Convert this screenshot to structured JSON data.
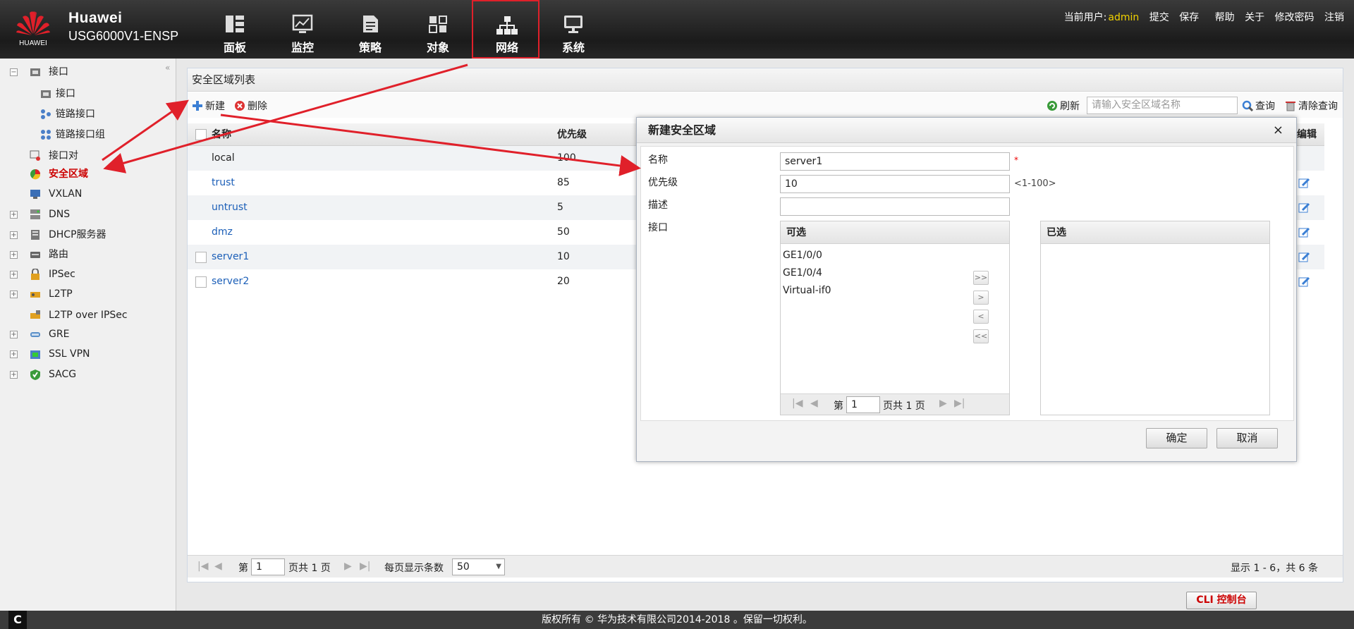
{
  "header": {
    "brand": "Huawei",
    "model": "USG6000V1-ENSP",
    "logo_text": "HUAWEI"
  },
  "nav": [
    {
      "label": "面板",
      "icon": "dashboard-icon"
    },
    {
      "label": "监控",
      "icon": "monitor-chart-icon"
    },
    {
      "label": "策略",
      "icon": "policy-document-icon"
    },
    {
      "label": "对象",
      "icon": "object-blocks-icon"
    },
    {
      "label": "网络",
      "icon": "network-topology-icon"
    },
    {
      "label": "系统",
      "icon": "system-monitor-icon"
    }
  ],
  "userbar": {
    "current_user_label": "当前用户:",
    "username": "admin",
    "submit": "提交",
    "save": "保存",
    "help": "帮助",
    "about": "关于",
    "change_password": "修改密码",
    "logout": "注销"
  },
  "sidebar": {
    "items": [
      {
        "label": "接口"
      },
      {
        "label": "接口"
      },
      {
        "label": "链路接口"
      },
      {
        "label": "链路接口组"
      },
      {
        "label": "接口对"
      },
      {
        "label": "安全区域"
      },
      {
        "label": "VXLAN"
      },
      {
        "label": "DNS"
      },
      {
        "label": "DHCP服务器"
      },
      {
        "label": "路由"
      },
      {
        "label": "IPSec"
      },
      {
        "label": "L2TP"
      },
      {
        "label": "L2TP over IPSec"
      },
      {
        "label": "GRE"
      },
      {
        "label": "SSL VPN"
      },
      {
        "label": "SACG"
      }
    ]
  },
  "panel": {
    "title": "安全区域列表"
  },
  "toolbar": {
    "new": "新建",
    "delete": "删除",
    "refresh": "刷新",
    "search_placeholder": "请输入安全区域名称",
    "query": "查询",
    "clear_query": "清除查询"
  },
  "table": {
    "columns": [
      "名称",
      "优先级",
      "编辑"
    ],
    "rows": [
      {
        "name": "local",
        "priority": "100"
      },
      {
        "name": "trust",
        "priority": "85"
      },
      {
        "name": "untrust",
        "priority": "5"
      },
      {
        "name": "dmz",
        "priority": "50"
      },
      {
        "name": "server1",
        "priority": "10"
      },
      {
        "name": "server2",
        "priority": "20"
      }
    ]
  },
  "pager": {
    "page_prefix": "第",
    "page": "1",
    "page_suffix": "页共 1 页",
    "per_page_label": "每页显示条数",
    "per_page": "50",
    "summary": "显示 1 - 6，共 6 条"
  },
  "dialog": {
    "title": "新建安全区域",
    "close": "×",
    "name_label": "名称",
    "name_value": "server1",
    "required_mark": "*",
    "priority_label": "优先级",
    "priority_value": "10",
    "priority_hint": "<1-100>",
    "desc_label": "描述",
    "desc_value": "",
    "interface_label": "接口",
    "available_title": "可选",
    "selected_title": "已选",
    "available": [
      "GE1/0/0",
      "GE1/0/4",
      "Virtual-if0"
    ],
    "move_all_right": ">>",
    "move_right": ">",
    "move_left": "<",
    "move_all_left": "<<",
    "list_page_prefix": "第",
    "list_page": "1",
    "list_page_suffix": "页共 1 页",
    "ok": "确定",
    "cancel": "取消"
  },
  "footer": {
    "copyright": "版权所有 © 华为技术有限公司2014-2018 。保留一切权利。",
    "cli": "CLI 控制台",
    "c_icon": "C"
  },
  "colors": {
    "accent_red": "#e0202a",
    "link": "#1c5fb8",
    "username": "#f1d200"
  }
}
